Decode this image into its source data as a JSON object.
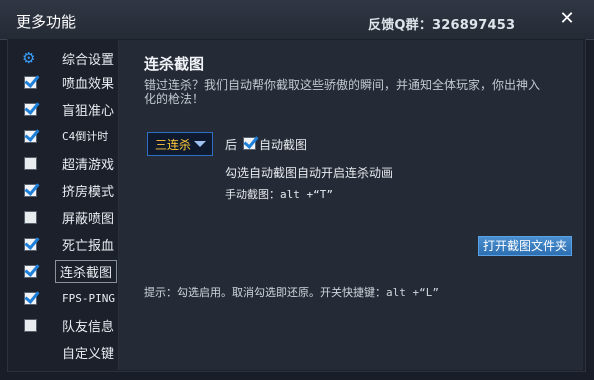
{
  "window": {
    "title": "更多功能",
    "feedback": "反馈Q群：326897453",
    "close_symbol": "✕"
  },
  "sidebar": {
    "items": [
      {
        "label": "综合设置",
        "state": "gear-icon"
      },
      {
        "label": "喷血效果",
        "state": "checked"
      },
      {
        "label": "盲狙准心",
        "state": "checked"
      },
      {
        "label": "C4倒计时",
        "state": "checked"
      },
      {
        "label": "超清游戏",
        "state": "unchecked"
      },
      {
        "label": "挤房模式",
        "state": "checked"
      },
      {
        "label": "屏蔽喷图",
        "state": "unchecked"
      },
      {
        "label": "死亡报血",
        "state": "checked"
      },
      {
        "label": "连杀截图",
        "state": "checked",
        "active": true
      },
      {
        "label": "FPS-PING",
        "state": "checked"
      },
      {
        "label": "队友信息",
        "state": "unchecked"
      },
      {
        "label": "自定义键",
        "state": "none"
      }
    ]
  },
  "main": {
    "heading": "连杀截图",
    "description": "错过连杀？我们自动帮你截取这些骄傲的瞬间，并通知全体玩家，你出神入化的枪法！",
    "combo_value": "三连杀",
    "after_label": "后",
    "auto_label": "自动截图",
    "auto_checked": true,
    "info_line1": "勾选自动截图自动开启连杀动画",
    "info_line2": "手动截图：alt +“T”",
    "open_button": "打开截图文件夹",
    "tip": "提示：勾选启用。取消勾选即还原。开关快捷键：alt +“L”"
  },
  "colors": {
    "accent_blue": "#1e7fd8",
    "combo_text": "#ffcb3a",
    "button_blue": "#3a7fc2"
  }
}
